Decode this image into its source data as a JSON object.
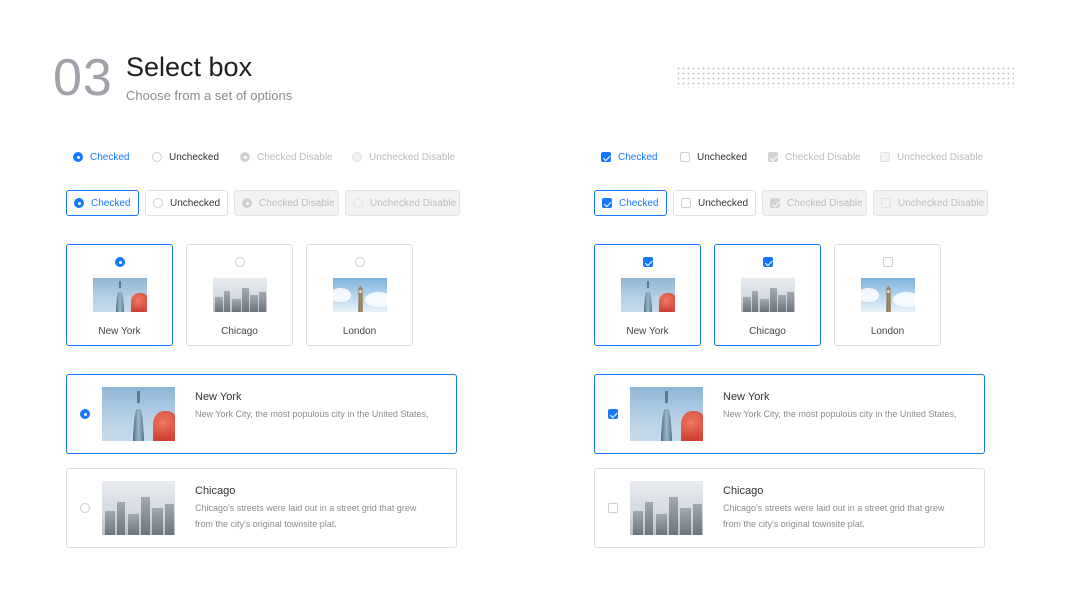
{
  "header": {
    "number": "03",
    "title": "Select box",
    "subtitle": "Choose from a set of options"
  },
  "colors": {
    "accent": "#1677ff",
    "muted": "#a1a1aa",
    "border": "#e0e0e0"
  },
  "radio": {
    "inline": [
      "Checked",
      "Unchecked",
      "Checked Disable",
      "Unchecked Disable"
    ],
    "bordered": [
      "Checked",
      "Unchecked",
      "Checked Disable",
      "Unchecked Disable"
    ],
    "cards": [
      "New York",
      "Chicago",
      "London"
    ],
    "list": [
      {
        "title": "New York",
        "desc": "New York City, the most populous city in the United States,"
      },
      {
        "title": "Chicago",
        "desc": "Chicago's streets were laid out in a street grid that grew from the city's original townsite plat."
      }
    ]
  },
  "checkbox": {
    "inline": [
      "Checked",
      "Unchecked",
      "Checked Disable",
      "Unchecked Disable"
    ],
    "bordered": [
      "Checked",
      "Unchecked",
      "Checked Disable",
      "Unchecked Disable"
    ],
    "cards": [
      "New York",
      "Chicago",
      "London"
    ],
    "list": [
      {
        "title": "New York",
        "desc": "New York City, the most populous city in the United States,"
      },
      {
        "title": "Chicago",
        "desc": "Chicago's streets were laid out in a street grid that grew from the city's original townsite plat."
      }
    ]
  },
  "icons": [
    "radio-icon",
    "checkbox-icon",
    "new-york-image",
    "chicago-image",
    "london-image"
  ]
}
